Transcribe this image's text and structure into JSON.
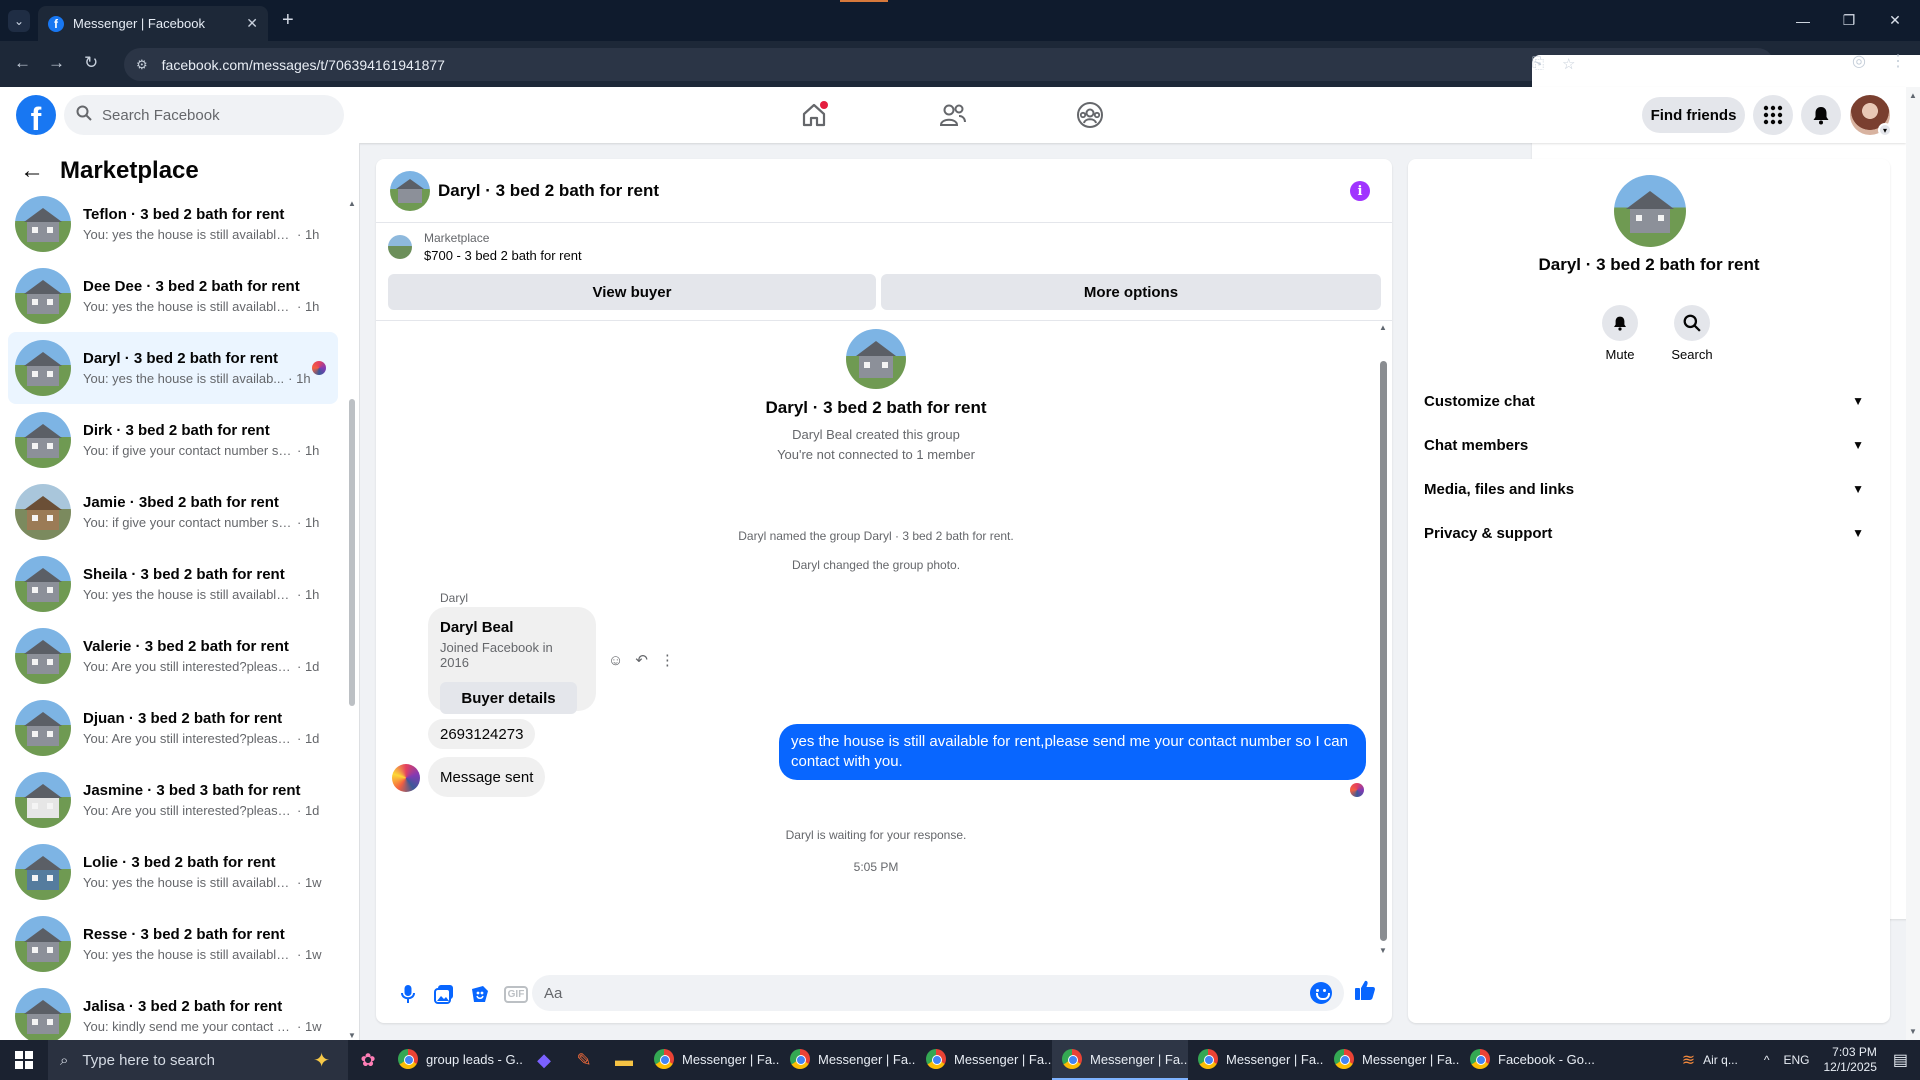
{
  "browser": {
    "tab_title": "Messenger | Facebook",
    "url": "facebook.com/messages/t/706394161941877"
  },
  "fbnav": {
    "search_placeholder": "Search Facebook",
    "find_friends": "Find friends"
  },
  "left": {
    "title": "Marketplace",
    "conversations": [
      {
        "name": "Teflon · 3 bed 2 bath for rent",
        "snippet": "You: yes the house is still available f...",
        "time": "1h"
      },
      {
        "name": "Dee Dee · 3 bed 2 bath for rent",
        "snippet": "You: yes the house is still available f...",
        "time": "1h"
      },
      {
        "name": "Daryl · 3 bed 2 bath for rent",
        "snippet": "You: yes the house is still availab...",
        "time": "1h"
      },
      {
        "name": "Dirk · 3 bed 2 bath for rent",
        "snippet": "You: if give your contact number se...",
        "time": "1h"
      },
      {
        "name": "Jamie · 3bed 2 bath for rent",
        "snippet": "You: if give your contact number se...",
        "time": "1h"
      },
      {
        "name": "Sheila · 3 bed 2 bath for rent",
        "snippet": "You: yes the house is still available f...",
        "time": "1h"
      },
      {
        "name": "Valerie · 3 bed 2 bath for rent",
        "snippet": "You: Are you still interested?please ...",
        "time": "1d"
      },
      {
        "name": "Djuan · 3 bed 2 bath for rent",
        "snippet": "You: Are you still interested?please ...",
        "time": "1d"
      },
      {
        "name": "Jasmine · 3 bed 3 bath for rent",
        "snippet": "You: Are you still interested?please ...",
        "time": "1d"
      },
      {
        "name": "Lolie · 3 bed 2 bath for rent",
        "snippet": "You: yes the house is still available ...",
        "time": "1w"
      },
      {
        "name": "Resse · 3 bed 2 bath for rent",
        "snippet": "You: yes the house is still available ...",
        "time": "1w"
      },
      {
        "name": "Jalisa · 3 bed 2 bath for rent",
        "snippet": "You: kindly send me your contact n...",
        "time": "1w"
      }
    ]
  },
  "chat": {
    "header_name": "Daryl · 3 bed 2 bath for rent",
    "marketplace_label": "Marketplace",
    "listing": "$700 - 3 bed 2 bath for rent",
    "view_buyer": "View buyer",
    "more_options": "More options",
    "group_name": "Daryl · 3 bed 2 bath for rent",
    "created": "Daryl Beal created this group",
    "not_connected": "You're not connected to 1 member",
    "named_event": "Daryl named the group Daryl · 3 bed 2 bath for rent.",
    "photo_event": "Daryl changed the group photo.",
    "sender": "Daryl",
    "card_name": "Daryl Beal",
    "card_sub": "Joined Facebook in 2016",
    "buyer_details": "Buyer details",
    "phone": "2693124273",
    "message_sent": "Message sent",
    "waiting": "Daryl is waiting for your response.",
    "time": "5:05 PM",
    "outgoing": "yes the house is still available for rent,please send me your contact number so I can contact with you.",
    "composer_placeholder": "Aa",
    "gif_label": "GIF"
  },
  "right": {
    "name": "Daryl · 3 bed 2 bath for rent",
    "mute": "Mute",
    "search": "Search",
    "sections": [
      "Customize chat",
      "Chat members",
      "Media, files and links",
      "Privacy & support"
    ]
  },
  "taskbar": {
    "search_placeholder": "Type here to search",
    "apps": [
      "group leads - G...",
      "Messenger | Fa...",
      "Messenger | Fa...",
      "Messenger | Fa...",
      "Messenger | Fa...",
      "Messenger | Fa...",
      "Messenger | Fa...",
      "Facebook - Go..."
    ],
    "weather": "Air q...",
    "lang": "ENG",
    "time": "7:03 PM",
    "date": "12/1/2025"
  },
  "colors": {
    "brand_blue": "#1877f2",
    "messenger_blue": "#0866ff",
    "active_conv_bg": "#ebf5ff",
    "info_purple": "#a033ff"
  }
}
